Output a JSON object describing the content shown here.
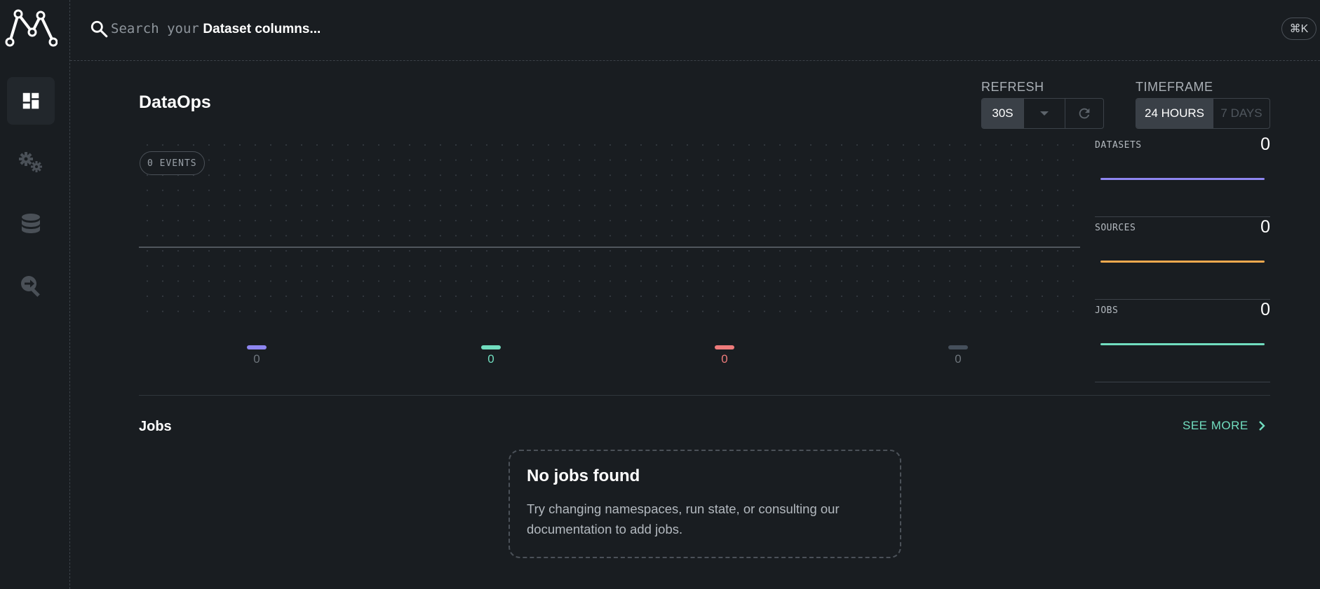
{
  "header": {
    "search": {
      "prefix": "Search your",
      "emphasis": "Dataset columns...",
      "icon": "search-icon"
    },
    "shortcut": "⌘K"
  },
  "sidebar": {
    "logo": "marquez-logo",
    "items": [
      {
        "name": "dashboard",
        "icon": "dashboard-icon",
        "active": true
      },
      {
        "name": "jobs",
        "icon": "gears-icon",
        "active": false
      },
      {
        "name": "datasets",
        "icon": "database-icon",
        "active": false
      },
      {
        "name": "events",
        "icon": "search-arrow-icon",
        "active": false
      }
    ]
  },
  "page": {
    "title": "DataOps"
  },
  "refresh": {
    "label": "REFRESH",
    "selected": "30S"
  },
  "timeframe": {
    "label": "TIMEFRAME",
    "options": [
      "24 HOURS",
      "7 DAYS"
    ],
    "selected": "24 HOURS"
  },
  "events": {
    "pill": "0 EVENTS",
    "legend": [
      {
        "value": "0",
        "color": "#8e86f0"
      },
      {
        "value": "0",
        "color": "#71ddbf"
      },
      {
        "value": "0",
        "color": "#ee7b7b"
      },
      {
        "value": "0",
        "color": "#454f5b"
      }
    ]
  },
  "stats": [
    {
      "label": "DATASETS",
      "value": "0",
      "color": "#8e86f0"
    },
    {
      "label": "SOURCES",
      "value": "0",
      "color": "#f0a94f"
    },
    {
      "label": "JOBS",
      "value": "0",
      "color": "#71ddbf"
    }
  ],
  "jobs": {
    "title": "Jobs",
    "see_more": "SEE MORE",
    "empty_title": "No jobs found",
    "empty_desc": "Try changing namespaces, run state, or consulting our documentation to add jobs."
  },
  "colors": {
    "background": "#191d21",
    "accent": "#71ddbf"
  }
}
